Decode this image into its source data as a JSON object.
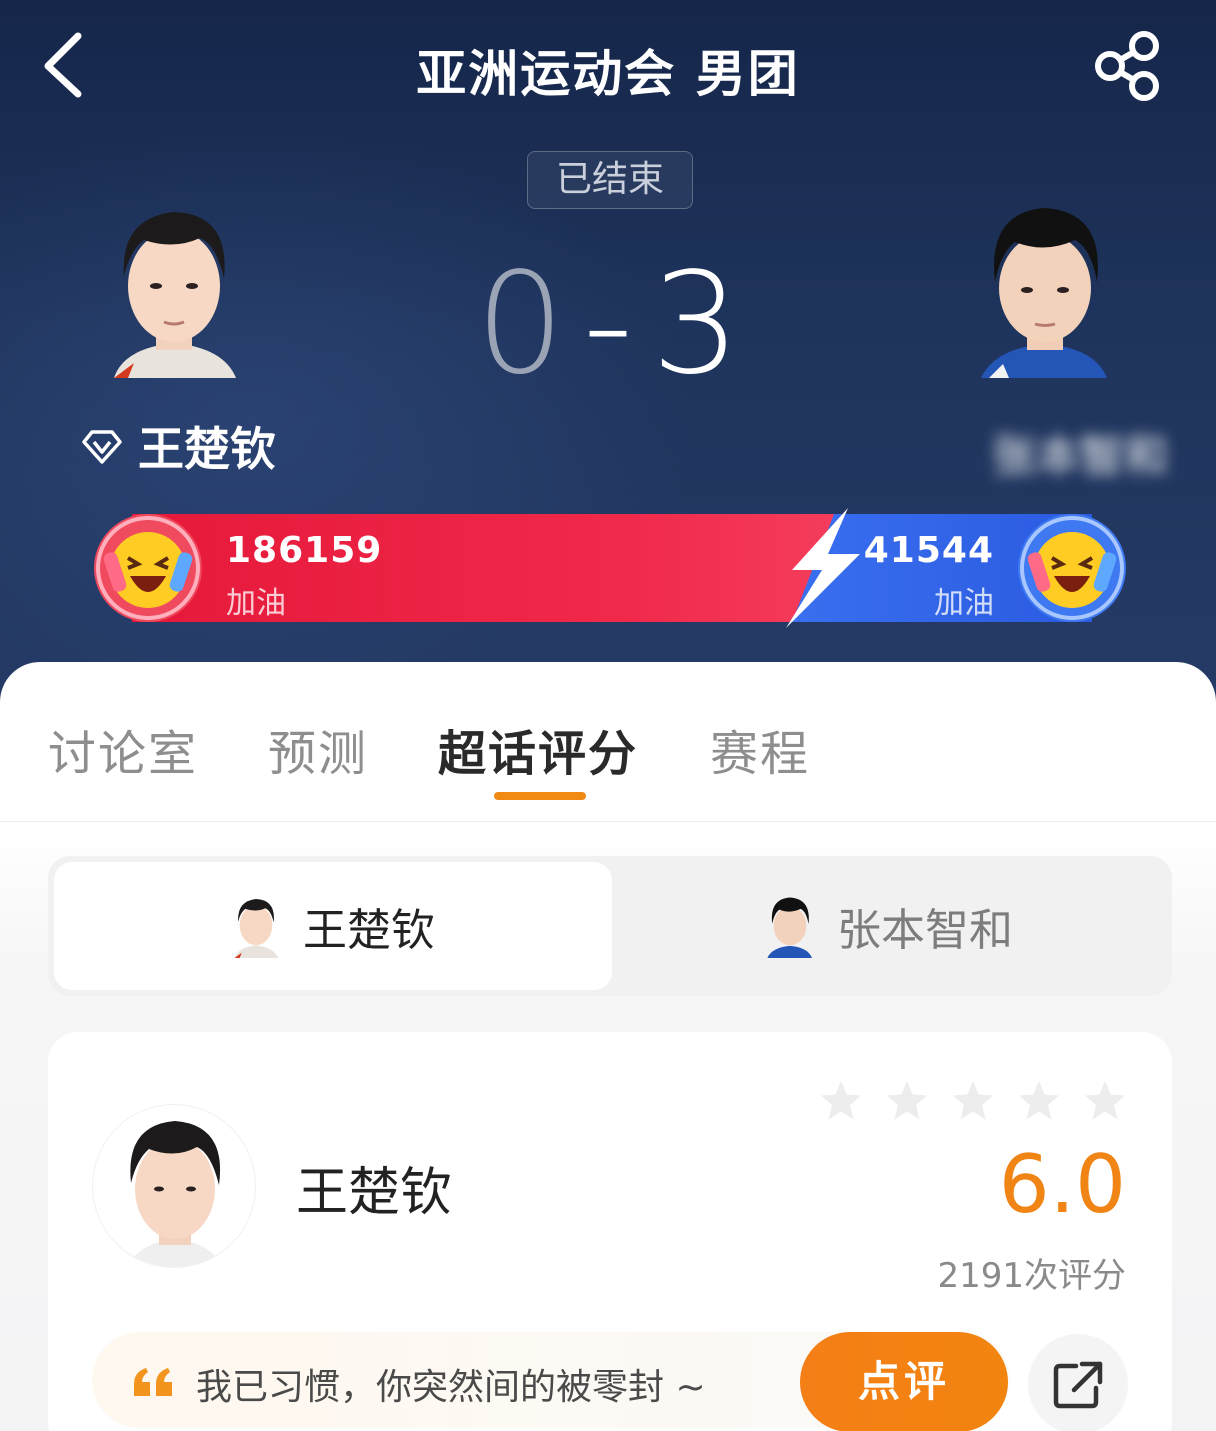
{
  "header": {
    "title": "亚洲运动会 男团",
    "status": "已结束"
  },
  "match": {
    "score_left": "0",
    "score_right": "3",
    "score_sep": "-",
    "left_player": "王楚钦",
    "right_player": "张本智和"
  },
  "cheer": {
    "left_count": "186159",
    "left_label": "加油",
    "right_count": "41544",
    "right_label": "加油",
    "left_color": "#e6193a",
    "right_color": "#3a6ff0"
  },
  "tabs": [
    {
      "label": "讨论室"
    },
    {
      "label": "预测"
    },
    {
      "label": "超话评分"
    },
    {
      "label": "赛程"
    }
  ],
  "active_tab": "超话评分",
  "player_switch": {
    "left": "王楚钦",
    "right": "张本智和"
  },
  "rating": {
    "player_name": "王楚钦",
    "score": "6.0",
    "count_text": "2191次评分",
    "stars_filled": 0,
    "stars_total": 5,
    "comment": "我已习惯，你突然间的被零封 ~",
    "review_button": "点评",
    "accent": "#f08414"
  }
}
